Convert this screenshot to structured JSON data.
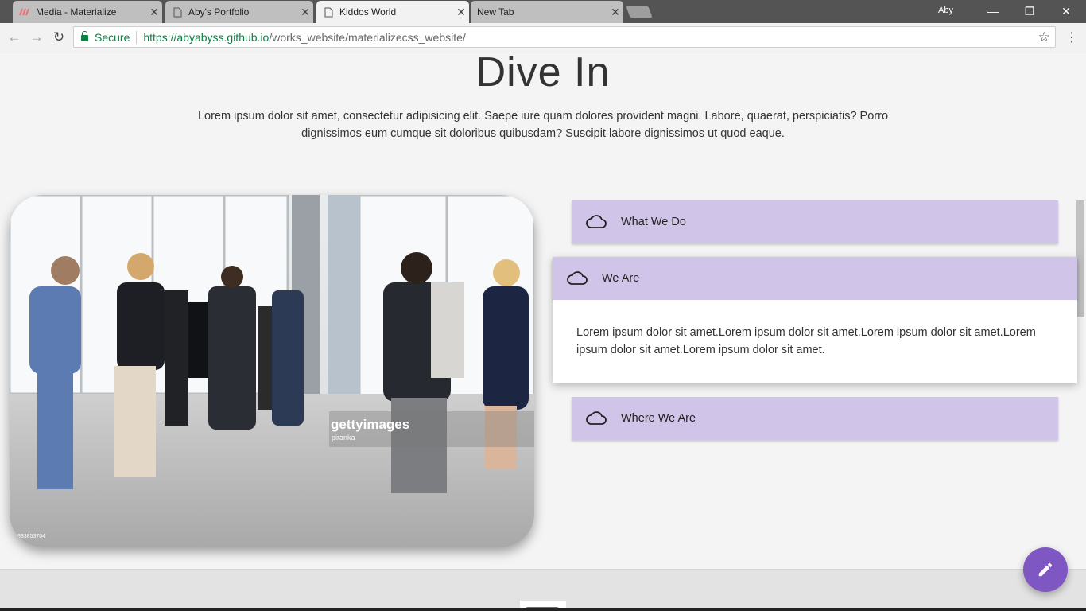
{
  "browser": {
    "tabs": [
      {
        "title": "Media - Materialize",
        "active": false,
        "favicon": "materialize-icon"
      },
      {
        "title": "Aby's Portfolio",
        "active": false,
        "favicon": "page-icon"
      },
      {
        "title": "Kiddos World",
        "active": true,
        "favicon": "page-icon"
      },
      {
        "title": "New Tab",
        "active": false,
        "favicon": "none"
      }
    ],
    "profile": "Aby",
    "secure_label": "Secure",
    "url_scheme_host": "https://abyabyss.github.io",
    "url_path": "/works_website/materializecss_website/"
  },
  "page": {
    "heading": "Dive In",
    "intro": "Lorem ipsum dolor sit amet, consectetur adipisicing elit. Saepe iure quam dolores provident magni. Labore, quaerat, perspiciatis? Porro dignissimos eum cumque sit doloribus quibusdam? Suscipit labore dignissimos ut quod eaque.",
    "photo": {
      "watermark": "gettyimages",
      "credit": "piranka",
      "id": "933853704"
    },
    "collapsible": [
      {
        "label": "What We Do",
        "icon": "cloud-icon",
        "expanded": false
      },
      {
        "label": "We Are",
        "icon": "cloud-icon",
        "expanded": true,
        "body": "Lorem ipsum dolor sit amet.Lorem ipsum dolor sit amet.Lorem ipsum dolor sit amet.Lorem ipsum dolor sit amet.Lorem ipsum dolor sit amet."
      },
      {
        "label": "Where We Are",
        "icon": "cloud-icon",
        "expanded": false
      }
    ],
    "fab_icon": "pencil-icon"
  },
  "colors": {
    "accent": "#7e57c2",
    "collapsible_header": "#d1c4e9",
    "background": "#f4f4f4",
    "secure_green": "#0b8043"
  }
}
